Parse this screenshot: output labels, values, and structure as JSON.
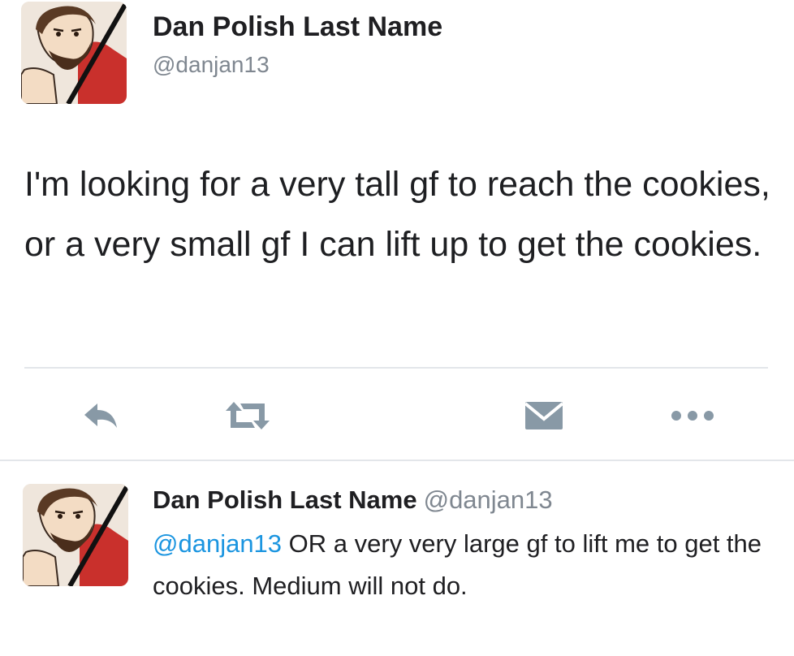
{
  "tweet": {
    "author_name": "Dan Polish Last Name",
    "author_handle": "@danjan13",
    "text": "I'm looking for a very tall gf to reach the cookies, or a very small gf I can lift up to get the cookies."
  },
  "actions": {
    "reply_icon": "reply-arrow",
    "retweet_icon": "retweet-arrows",
    "dm_icon": "envelope",
    "more_icon": "three-dots"
  },
  "reply": {
    "author_name": "Dan Polish Last Name",
    "author_handle": "@danjan13",
    "mention": "@danjan13",
    "text": " OR a very very large gf to lift me to get the cookies. Medium will not do."
  },
  "colors": {
    "mention": "#1b95e0",
    "handle": "#7f8790",
    "icon": "#8899a6"
  }
}
